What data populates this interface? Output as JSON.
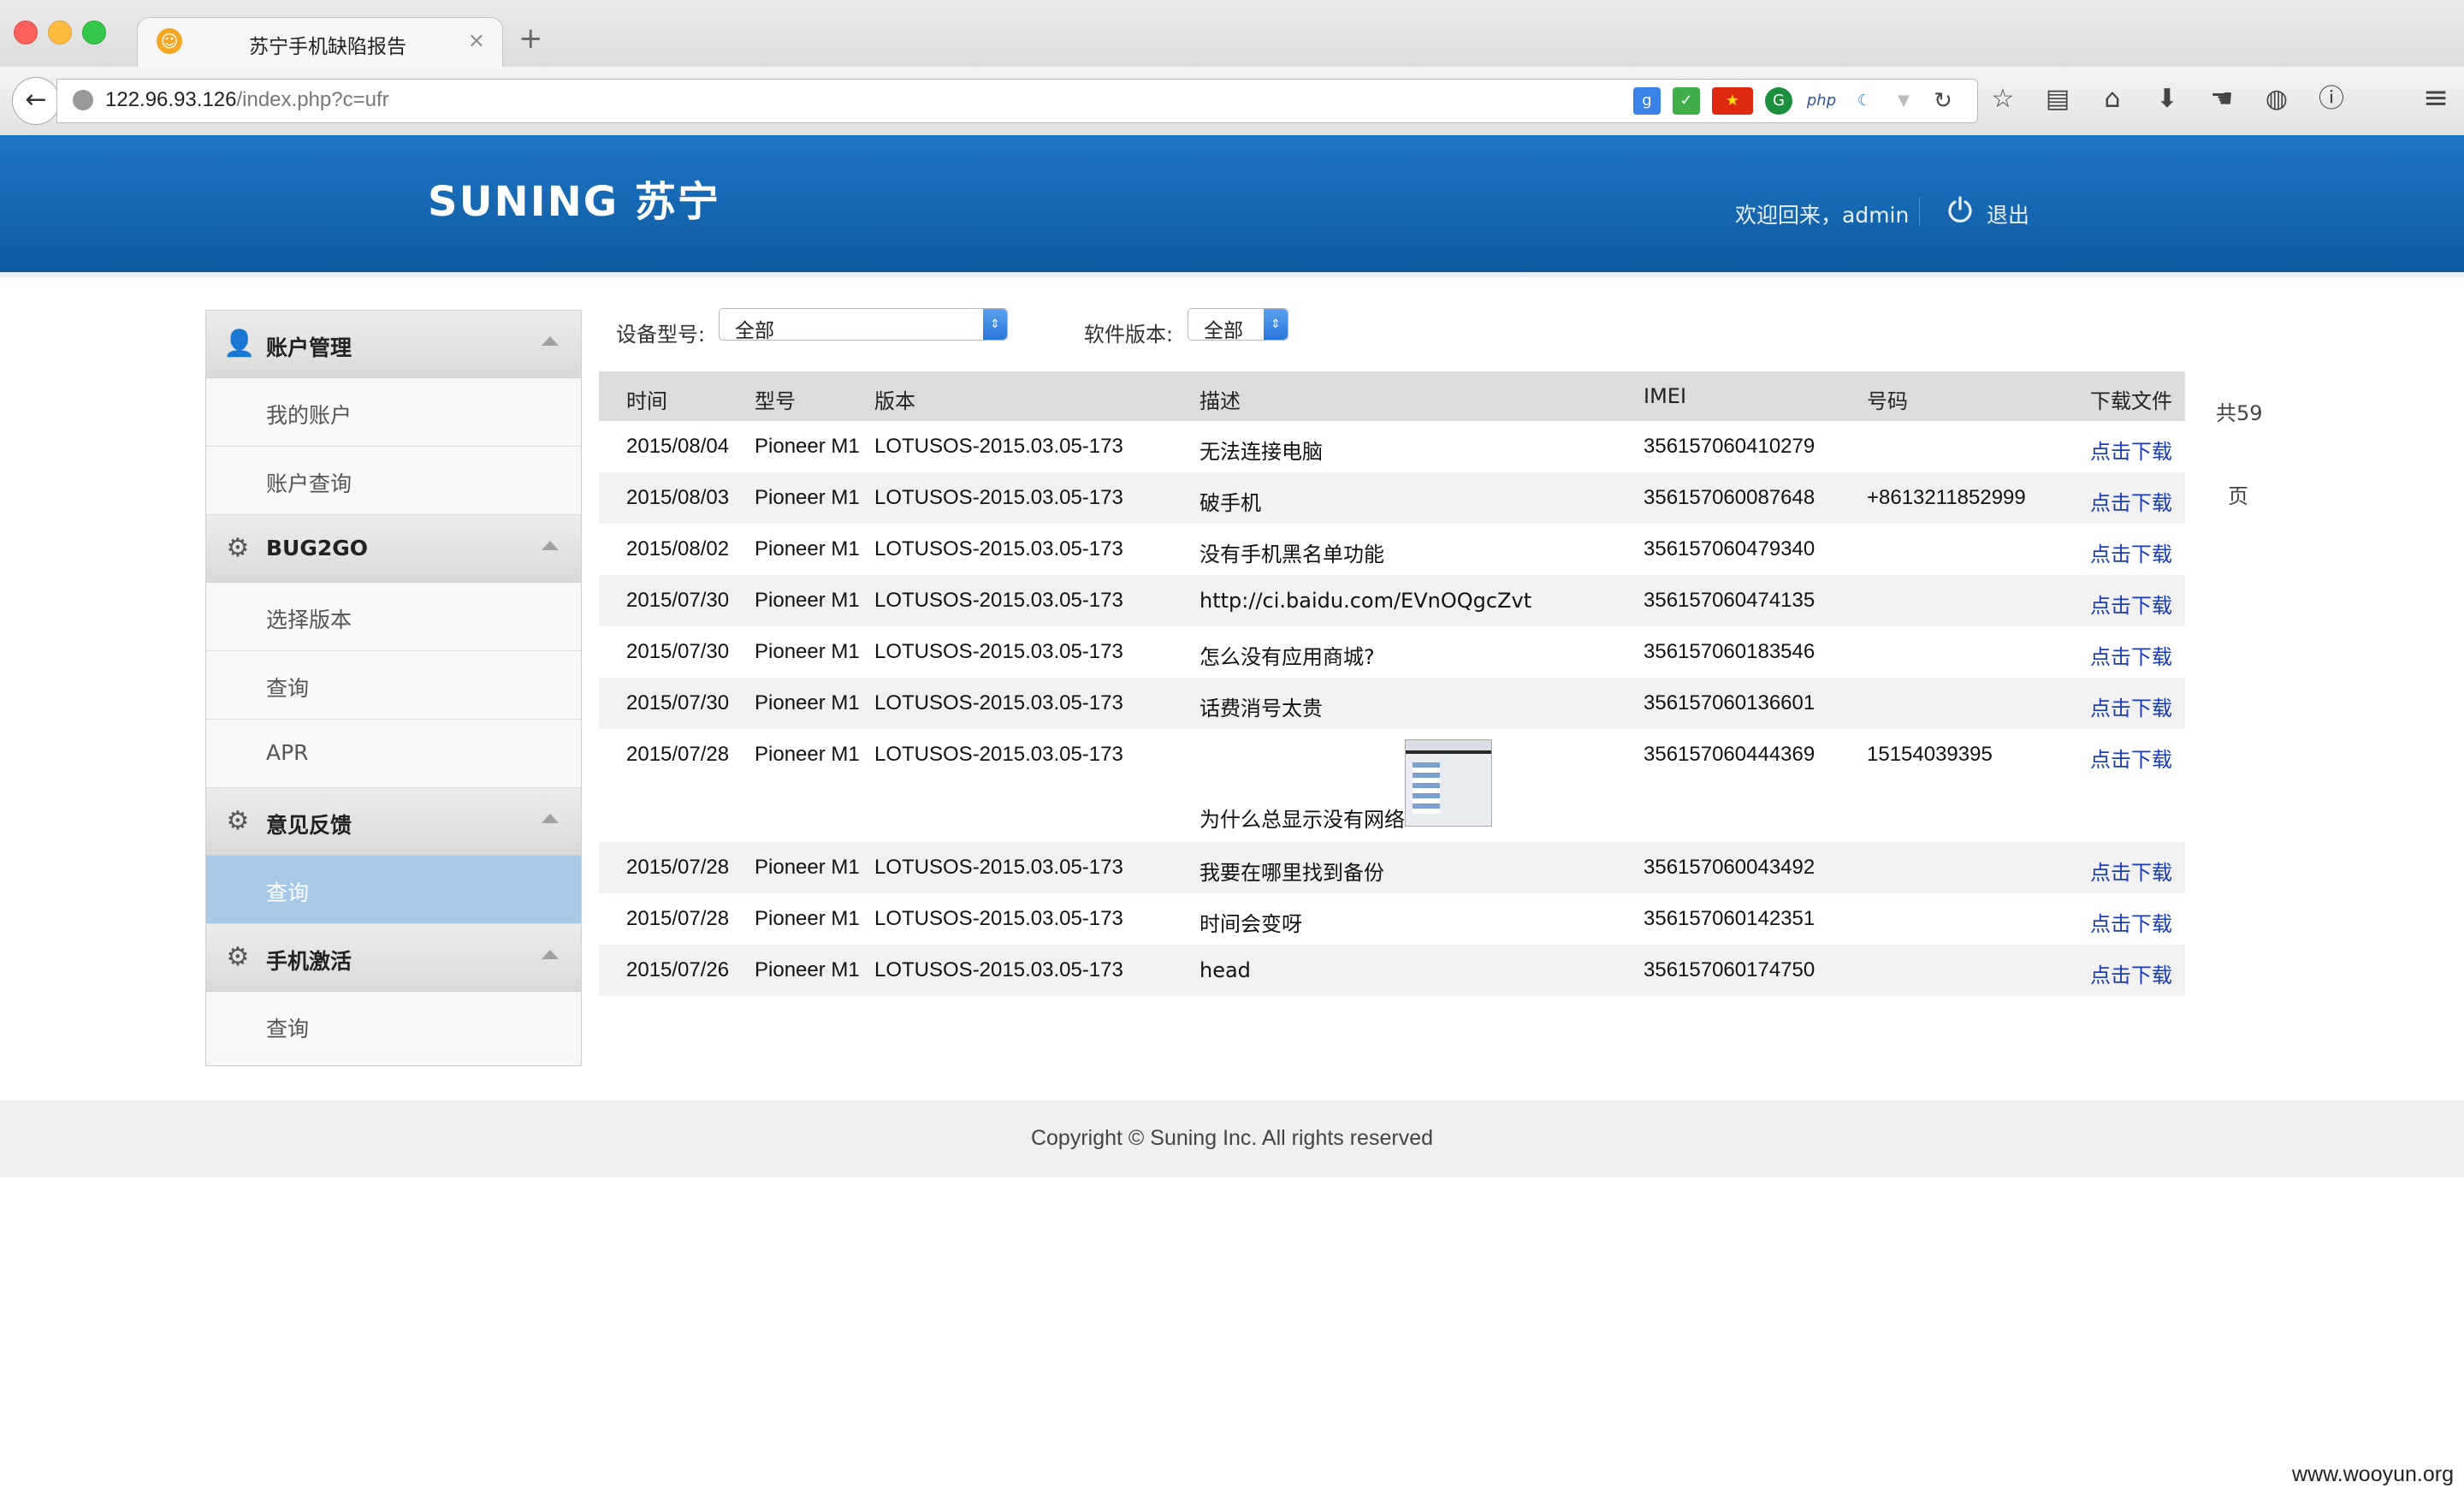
{
  "browser": {
    "tab_title": "苏宁手机缺陷报告",
    "tab_close": "×",
    "new_tab": "+",
    "url_host": "122.96.93.126",
    "url_path": "/index.php?c=ufr"
  },
  "header": {
    "logo": "SUNING 苏宁",
    "welcome": "欢迎回来，admin",
    "logout": "退出"
  },
  "sidebar": {
    "sections": [
      {
        "title": "账户管理",
        "icon": "user-icon",
        "items": [
          "我的账户",
          "账户查询"
        ]
      },
      {
        "title": "BUG2GO",
        "icon": "gear-icon",
        "items": [
          "选择版本",
          "查询",
          "APR"
        ]
      },
      {
        "title": "意见反馈",
        "icon": "gear-icon",
        "items": [
          "查询"
        ]
      },
      {
        "title": "手机激活",
        "icon": "gear-icon",
        "items": [
          "查询"
        ]
      }
    ],
    "active_item": "意见反馈 / 查询",
    "active_color": "#a8c8e8"
  },
  "filters": {
    "device_label": "设备型号:",
    "device_value": "全部",
    "version_label": "软件版本:",
    "version_value": "全部"
  },
  "table": {
    "headers": [
      "时间",
      "型号",
      "版本",
      "描述",
      "IMEI",
      "号码",
      "下载文件"
    ],
    "rows": [
      {
        "time": "2015/08/04",
        "model": "Pioneer M1",
        "version": "LOTUSOS-2015.03.05-173",
        "desc": "无法连接电脑",
        "imei": "356157060410279",
        "phone": "",
        "download": "点击下载"
      },
      {
        "time": "2015/08/03",
        "model": "Pioneer M1",
        "version": "LOTUSOS-2015.03.05-173",
        "desc": "破手机",
        "imei": "356157060087648",
        "phone": "+8613211852999",
        "download": "点击下载"
      },
      {
        "time": "2015/08/02",
        "model": "Pioneer M1",
        "version": "LOTUSOS-2015.03.05-173",
        "desc": "没有手机黑名单功能",
        "imei": "356157060479340",
        "phone": "",
        "download": "点击下载"
      },
      {
        "time": "2015/07/30",
        "model": "Pioneer M1",
        "version": "LOTUSOS-2015.03.05-173",
        "desc": "http://ci.baidu.com/EVnOQgcZvt",
        "imei": "356157060474135",
        "phone": "",
        "download": "点击下载"
      },
      {
        "time": "2015/07/30",
        "model": "Pioneer M1",
        "version": "LOTUSOS-2015.03.05-173",
        "desc": "怎么没有应用商城?",
        "imei": "356157060183546",
        "phone": "",
        "download": "点击下载"
      },
      {
        "time": "2015/07/30",
        "model": "Pioneer M1",
        "version": "LOTUSOS-2015.03.05-173",
        "desc": "话费消号太贵",
        "imei": "356157060136601",
        "phone": "",
        "download": "点击下载"
      },
      {
        "time": "2015/07/28",
        "model": "Pioneer M1",
        "version": "LOTUSOS-2015.03.05-173",
        "desc": "为什么总显示没有网络",
        "imei": "356157060444369",
        "phone": "15154039395",
        "download": "点击下载"
      },
      {
        "time": "2015/07/28",
        "model": "Pioneer M1",
        "version": "LOTUSOS-2015.03.05-173",
        "desc": "我要在哪里找到备份",
        "imei": "356157060043492",
        "phone": "",
        "download": "点击下载"
      },
      {
        "time": "2015/07/28",
        "model": "Pioneer M1",
        "version": "LOTUSOS-2015.03.05-173",
        "desc": "时间会变呀",
        "imei": "356157060142351",
        "phone": "",
        "download": "点击下载"
      },
      {
        "time": "2015/07/26",
        "model": "Pioneer M1",
        "version": "LOTUSOS-2015.03.05-173",
        "desc": "head",
        "imei": "356157060174750",
        "phone": "",
        "download": "点击下载"
      }
    ]
  },
  "pager": {
    "total": "共59",
    "unit": "页"
  },
  "footer": {
    "copyright": "Copyright © Suning Inc. All rights reserved"
  },
  "watermark": "www.wooyun.org",
  "colors": {
    "header_blue": "#1565b0",
    "link": "#1a3cb8"
  }
}
